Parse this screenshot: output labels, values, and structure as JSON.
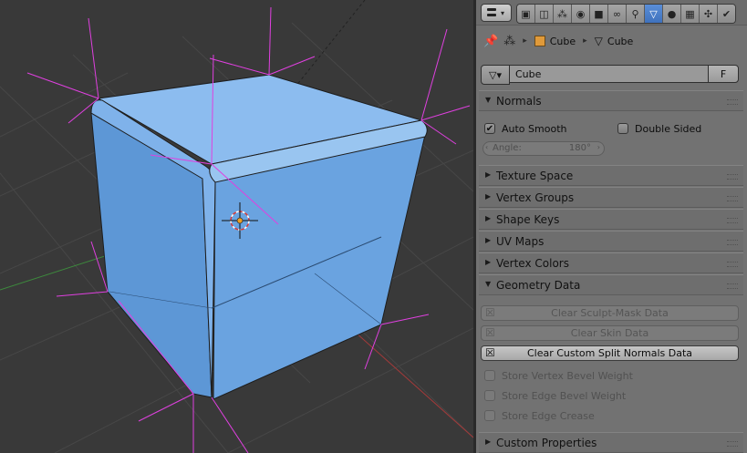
{
  "header": {
    "editor_type_icon": "properties-editor-icon",
    "context_tabs": [
      {
        "icon": "render-icon",
        "glyph": "▣",
        "active": false
      },
      {
        "icon": "render-layers-icon",
        "glyph": "◫",
        "active": false
      },
      {
        "icon": "scene-icon",
        "glyph": "⁂",
        "active": false
      },
      {
        "icon": "world-icon",
        "glyph": "◉",
        "active": false
      },
      {
        "icon": "object-icon",
        "glyph": "■",
        "active": false
      },
      {
        "icon": "constraints-icon",
        "glyph": "∞",
        "active": false
      },
      {
        "icon": "modifiers-icon",
        "glyph": "⚲",
        "active": false
      },
      {
        "icon": "mesh-data-icon",
        "glyph": "▽",
        "active": true
      },
      {
        "icon": "material-icon",
        "glyph": "●",
        "active": false
      },
      {
        "icon": "texture-icon",
        "glyph": "▦",
        "active": false
      },
      {
        "icon": "particles-icon",
        "glyph": "✣",
        "active": false
      },
      {
        "icon": "physics-icon",
        "glyph": "✔",
        "active": false
      }
    ]
  },
  "breadcrumb": {
    "object_name": "Cube",
    "mesh_name": "Cube"
  },
  "mesh_selector": {
    "name": "Cube",
    "fake_user_label": "F"
  },
  "panels": {
    "normals": {
      "title": "Normals",
      "auto_smooth_label": "Auto Smooth",
      "auto_smooth_checked": true,
      "double_sided_label": "Double Sided",
      "double_sided_checked": false,
      "angle_label": "Angle:",
      "angle_value": "180°"
    },
    "collapsed": [
      {
        "title": "Texture Space"
      },
      {
        "title": "Vertex Groups"
      },
      {
        "title": "Shape Keys"
      },
      {
        "title": "UV Maps"
      },
      {
        "title": "Vertex Colors"
      }
    ],
    "geometry_data": {
      "title": "Geometry Data",
      "buttons": [
        {
          "label": "Clear Sculpt-Mask Data",
          "enabled": false
        },
        {
          "label": "Clear Skin Data",
          "enabled": false
        },
        {
          "label": "Clear Custom Split Normals Data",
          "enabled": true
        }
      ],
      "checkboxes": [
        {
          "label": "Store Vertex Bevel Weight",
          "checked": false
        },
        {
          "label": "Store Edge Bevel Weight",
          "checked": false
        },
        {
          "label": "Store Edge Crease",
          "checked": false
        }
      ]
    },
    "custom_properties": {
      "title": "Custom Properties"
    }
  },
  "colors": {
    "mesh_face": "#5b93d4",
    "normals": "#e040e0",
    "grid": "#474747",
    "x_axis": "#a33a3a",
    "y_axis": "#3d8a3d",
    "active_tab": "#4a7fc8"
  }
}
